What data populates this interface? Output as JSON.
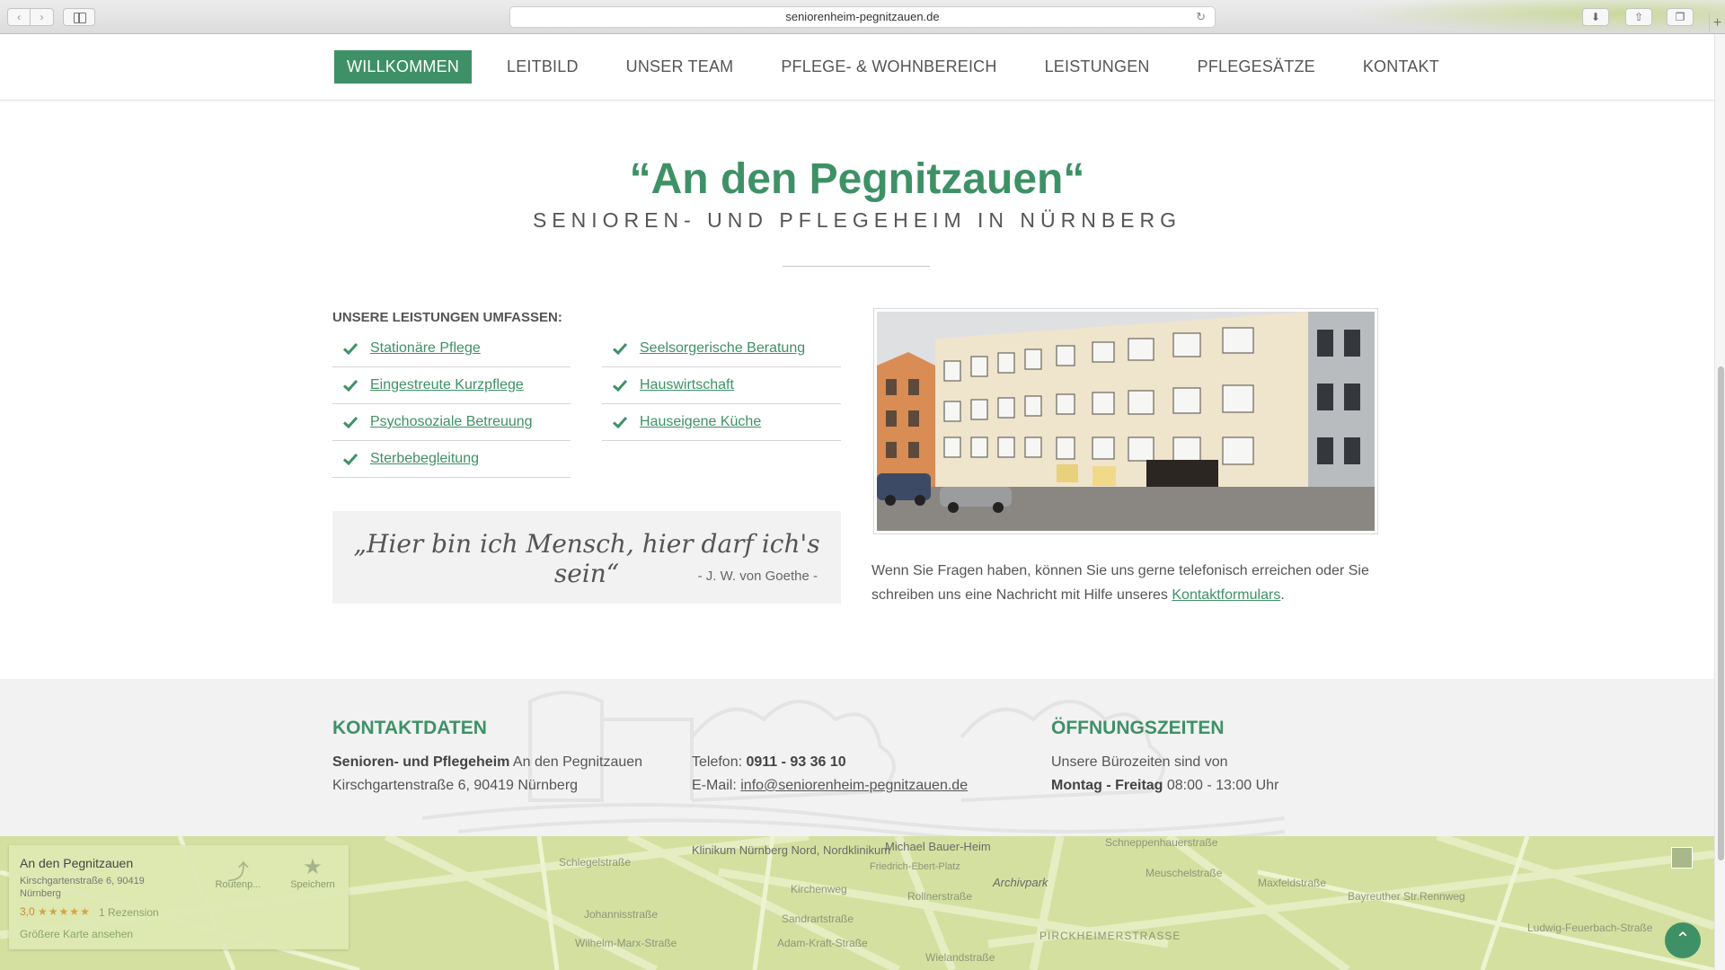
{
  "browser": {
    "url": "seniorenheim-pegnitzauen.de"
  },
  "nav": {
    "items": [
      "WILLKOMMEN",
      "LEITBILD",
      "UNSER TEAM",
      "PFLEGE- & WOHNBEREICH",
      "LEISTUNGEN",
      "PFLEGESÄTZE",
      "KONTAKT"
    ],
    "active": "WILLKOMMEN"
  },
  "hero": {
    "title": "“An den Pegnitzauen“",
    "subtitle": "SENIOREN- UND PFLEGEHEIM IN NÜRNBERG"
  },
  "services": {
    "heading": "UNSERE LEISTUNGEN UMFASSEN:",
    "left": [
      "Stationäre Pflege",
      "Eingestreute Kurzpflege",
      "Psychosoziale Betreuung",
      "Sterbebegleitung"
    ],
    "right": [
      "Seelsorgerische Beratung",
      "Hauswirtschaft",
      "Hauseigene Küche"
    ]
  },
  "quote": {
    "text": "„Hier bin ich Mensch, hier darf ich's sein“",
    "author": "- J. W. von Goethe -"
  },
  "contact_note": {
    "text": "Wenn Sie Fragen haben, können Sie uns gerne telefonisch erreichen oder Sie schreiben uns eine Nachricht mit Hilfe unseres ",
    "link": "Kontaktformulars",
    "end": "."
  },
  "footer": {
    "contact_heading": "KONTAKTDATEN",
    "org_bold": "Senioren- und Pflegeheim",
    "org_rest": " An den Pegnitzauen",
    "address": "Kirschgartenstraße 6, 90419 Nürnberg",
    "phone_label": "Telefon: ",
    "phone": "0911 - 93 36 10",
    "email_label": "E-Mail: ",
    "email": "info@seniorenheim-pegnitzauen.de",
    "hours_heading": "ÖFFNUNGSZEITEN",
    "hours_intro": "Unsere Bürozeiten sind von",
    "hours_days": "Montag - Freitag",
    "hours_time": " 08:00 - 13:00 Uhr"
  },
  "map": {
    "card_name": "An den Pegnitzauen",
    "card_address": "Kirschgartenstraße 6, 90419 Nürnberg",
    "rating": "3,0",
    "stars": "★★★★★",
    "reviews": "1 Rezension",
    "bigger_map": "Größere Karte ansehen",
    "route": "Routenp...",
    "save": "Speichern",
    "labels": {
      "hospital": "Klinikum Nürnberg Nord, Nordklinikum",
      "michael": "Michael Bauer-Heim",
      "friedrich": "Friedrich-Ebert-Platz",
      "archivpark": "Archivpark",
      "meuschel": "Meuschelstraße",
      "maxfeld": "Maxfeldstraße",
      "pirckheimer": "PIRCKHEIMERSTRASSE",
      "kirchenweg": "Kirchenweg",
      "sandrart": "Sandrartstraße",
      "johannis": "Johannisstraße",
      "wilhelm": "Wilhelm-Marx-Straße",
      "adam": "Adam-Kraft-Straße",
      "wieland": "Wielandstraße",
      "rollner": "Rollnerstraße",
      "ludwig": "Ludwig-Feuerbach-Straße",
      "schneppen": "Schneppenhauerstraße",
      "schlegel": "Schlegelstraße",
      "rennweg": "Rennweg",
      "badstr": "Bayreuther Str."
    }
  },
  "colors": {
    "accent": "#3e9166",
    "footer_bg": "#f2f2f2",
    "map_bg": "#d4e0a0"
  }
}
